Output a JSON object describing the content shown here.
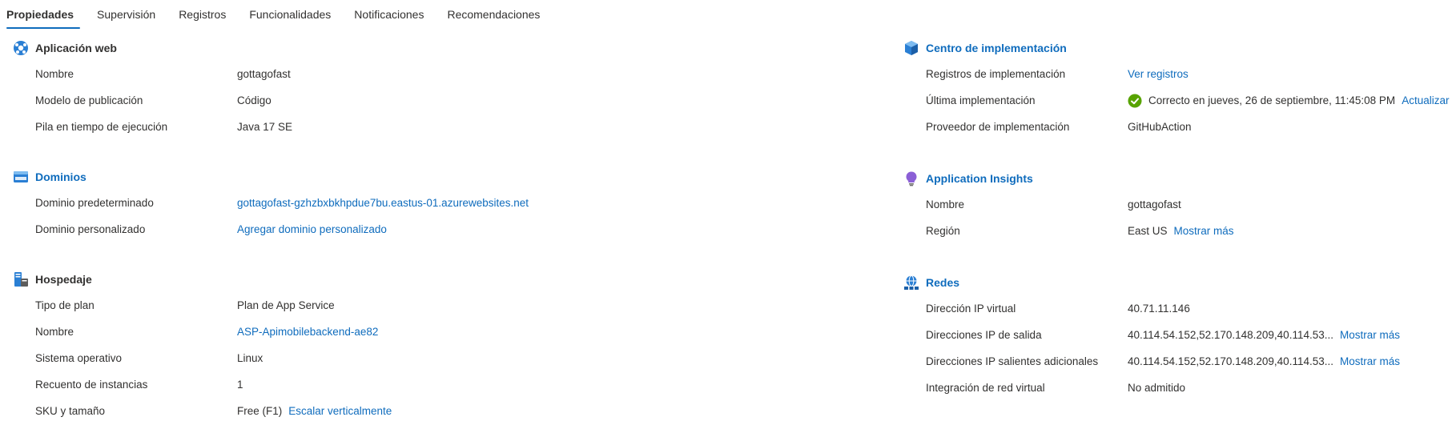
{
  "tabs": [
    {
      "label": "Propiedades",
      "active": true
    },
    {
      "label": "Supervisión",
      "active": false
    },
    {
      "label": "Registros",
      "active": false
    },
    {
      "label": "Funcionalidades",
      "active": false
    },
    {
      "label": "Notificaciones",
      "active": false
    },
    {
      "label": "Recomendaciones",
      "active": false
    }
  ],
  "left": {
    "webapp": {
      "title": "Aplicación web",
      "icon": "web-app-icon",
      "rows": [
        {
          "label": "Nombre",
          "value": "gottagofast"
        },
        {
          "label": "Modelo de publicación",
          "value": "Código"
        },
        {
          "label": "Pila en tiempo de ejecución",
          "value": "Java 17 SE"
        }
      ]
    },
    "domains": {
      "title": "Dominios",
      "icon": "domains-icon",
      "rows": [
        {
          "label": "Dominio predeterminado",
          "value": "gottagofast-gzhzbxbkhpdue7bu.eastus-01.azurewebsites.net"
        },
        {
          "label": "Dominio personalizado",
          "value": "Agregar dominio personalizado"
        }
      ]
    },
    "hosting": {
      "title": "Hospedaje",
      "icon": "hosting-icon",
      "rows": [
        {
          "label": "Tipo de plan",
          "value": "Plan de App Service"
        },
        {
          "label": "Nombre",
          "value": "ASP-Apimobilebackend-ae82"
        },
        {
          "label": "Sistema operativo",
          "value": "Linux"
        },
        {
          "label": "Recuento de instancias",
          "value": "1"
        },
        {
          "label": "SKU y tamaño",
          "value": "Free (F1)",
          "action": "Escalar verticalmente"
        }
      ]
    }
  },
  "right": {
    "deployment": {
      "title": "Centro de implementación",
      "icon": "deployment-center-icon",
      "rows": [
        {
          "label": "Registros de implementación",
          "value": "Ver registros"
        },
        {
          "label": "Última implementación",
          "value": "Correcto en jueves, 26 de septiembre, 11:45:08 PM",
          "action": "Actualizar",
          "status_icon": "success-check-icon"
        },
        {
          "label": "Proveedor de implementación",
          "value": "GitHubAction"
        }
      ]
    },
    "insights": {
      "title": "Application Insights",
      "icon": "application-insights-icon",
      "rows": [
        {
          "label": "Nombre",
          "value": "gottagofast"
        },
        {
          "label": "Región",
          "value": "East US",
          "action": "Mostrar más"
        }
      ]
    },
    "networking": {
      "title": "Redes",
      "icon": "networking-icon",
      "rows": [
        {
          "label": "Dirección IP virtual",
          "value": "40.71.11.146"
        },
        {
          "label": "Direcciones IP de salida",
          "value": "40.114.54.152,52.170.148.209,40.114.53...",
          "action": "Mostrar más"
        },
        {
          "label": "Direcciones IP salientes adicionales",
          "value": "40.114.54.152,52.170.148.209,40.114.53...",
          "action": "Mostrar más"
        },
        {
          "label": "Integración de red virtual",
          "value": "No admitido"
        }
      ]
    }
  },
  "colors": {
    "accent": "#0f6cbd",
    "text": "#323130",
    "success": "#57a300"
  }
}
